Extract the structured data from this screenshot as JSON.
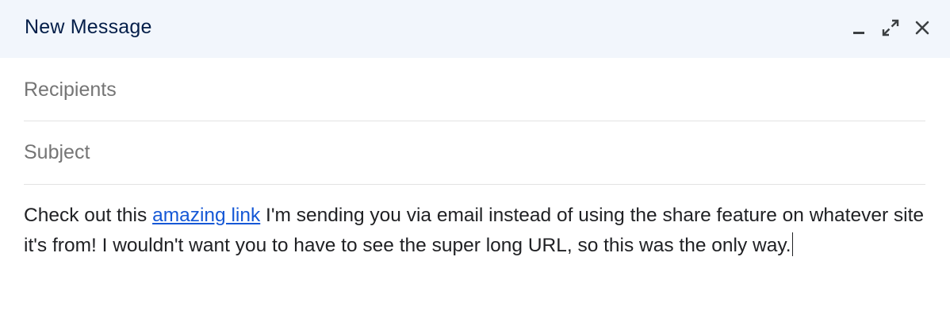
{
  "window": {
    "title": "New Message",
    "controls": {
      "minimize_icon": "minimize-icon",
      "expand_icon": "expand-icon",
      "close_icon": "close-icon"
    }
  },
  "fields": {
    "recipients_placeholder": "Recipients",
    "recipients_value": "",
    "subject_placeholder": "Subject",
    "subject_value": ""
  },
  "body": {
    "text_before_link": "Check out this ",
    "link_text": "amazing link",
    "text_after_link": " I'm sending you via email instead of using the share feature on whatever site it's from! I wouldn't want you to have to see the super long URL, so this was the only way."
  },
  "colors": {
    "header_bg": "#f2f6fc",
    "title": "#041e49",
    "link": "#1558d6",
    "placeholder": "#757575"
  }
}
